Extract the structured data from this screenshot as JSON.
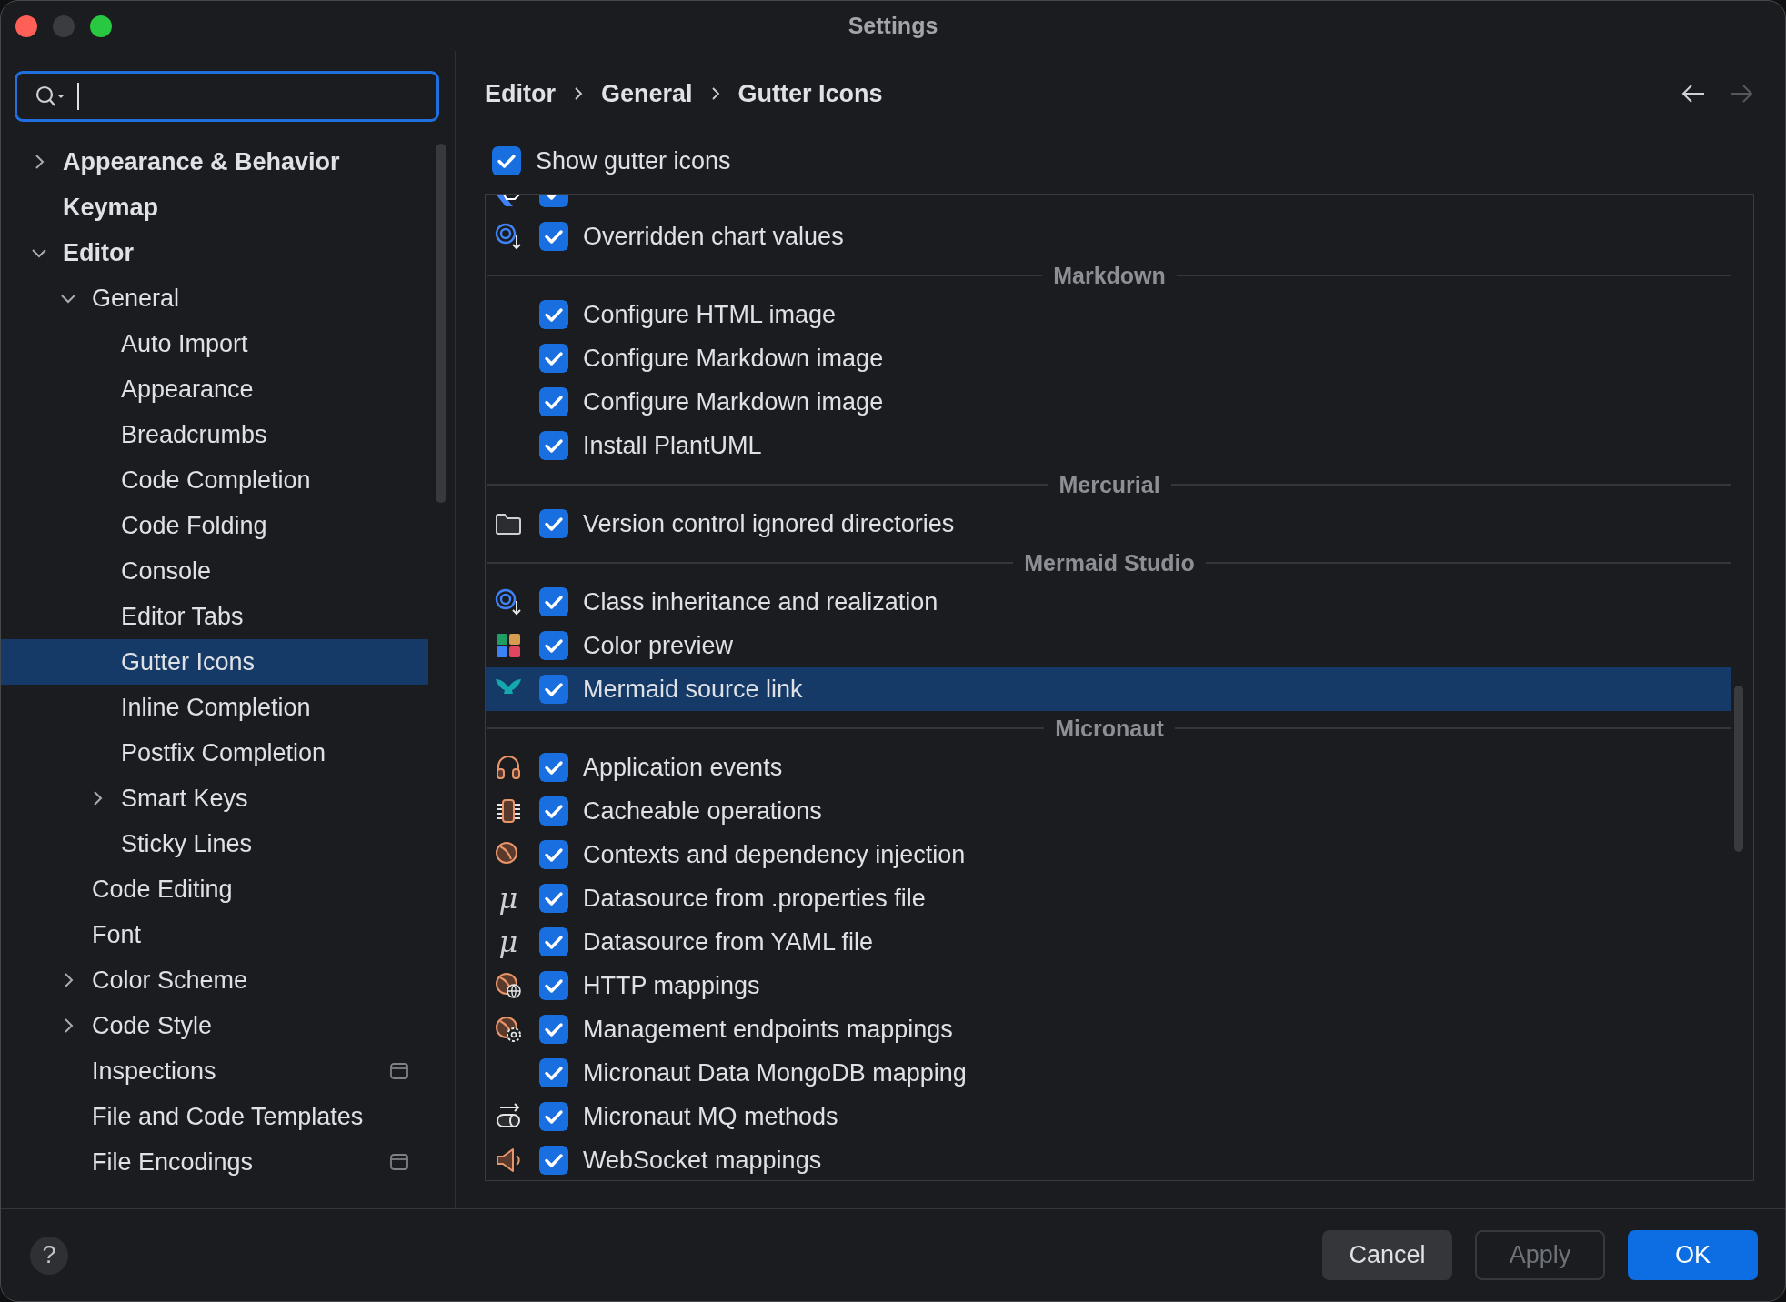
{
  "window": {
    "title": "Settings",
    "buttons": [
      {
        "kind": "close",
        "disabled": false
      },
      {
        "kind": "minimize",
        "disabled": true
      },
      {
        "kind": "zoom",
        "disabled": false
      }
    ]
  },
  "sidebar": {
    "tree": [
      {
        "label": "Appearance & Behavior",
        "selected": false,
        "expanded": false
      },
      {
        "label": "Keymap",
        "selected": false
      },
      {
        "label": "Editor",
        "selected": false,
        "expanded": true,
        "children": [
          {
            "label": "General",
            "selected": false,
            "expanded": true,
            "children": [
              {
                "label": "Auto Import",
                "selected": false
              },
              {
                "label": "Appearance",
                "selected": false
              },
              {
                "label": "Breadcrumbs",
                "selected": false
              },
              {
                "label": "Code Completion",
                "selected": false
              },
              {
                "label": "Code Folding",
                "selected": false
              },
              {
                "label": "Console",
                "selected": false
              },
              {
                "label": "Editor Tabs",
                "selected": false
              },
              {
                "label": "Gutter Icons",
                "selected": true
              },
              {
                "label": "Inline Completion",
                "selected": false
              },
              {
                "label": "Postfix Completion",
                "selected": false
              },
              {
                "label": "Smart Keys",
                "selected": false,
                "expanded": false
              },
              {
                "label": "Sticky Lines",
                "selected": false
              }
            ]
          },
          {
            "label": "Code Editing",
            "selected": false,
            "per_project": false
          },
          {
            "label": "Font",
            "selected": false,
            "per_project": false
          },
          {
            "label": "Color Scheme",
            "selected": false,
            "expanded": false,
            "per_project": false
          },
          {
            "label": "Code Style",
            "selected": false,
            "expanded": false,
            "per_project": false
          },
          {
            "label": "Inspections",
            "selected": false,
            "per_project": true
          },
          {
            "label": "File and Code Templates",
            "selected": false,
            "per_project": false
          },
          {
            "label": "File Encodings",
            "selected": false,
            "per_project": true
          }
        ]
      }
    ]
  },
  "breadcrumbs": [
    "Editor",
    "General",
    "Gutter Icons"
  ],
  "navigation": [
    {
      "kind": "back",
      "disabled": false
    },
    {
      "kind": "forward",
      "disabled": true
    }
  ],
  "show_gutter_icons": {
    "label": "Show gutter icons",
    "checked": true
  },
  "gutter_list": {
    "rows": [
      {
        "kind": "option",
        "checked": true,
        "selected": false
      },
      {
        "kind": "option",
        "label": "Overridden chart values",
        "checked": true,
        "selected": false
      },
      {
        "kind": "group",
        "label": "Markdown"
      },
      {
        "kind": "option",
        "label": "Configure HTML image",
        "checked": true,
        "selected": false
      },
      {
        "kind": "option",
        "label": "Configure Markdown image",
        "checked": true,
        "selected": false
      },
      {
        "kind": "option",
        "label": "Configure Markdown image",
        "checked": true,
        "selected": false
      },
      {
        "kind": "option",
        "label": "Install PlantUML",
        "checked": true,
        "selected": false
      },
      {
        "kind": "group",
        "label": "Mercurial"
      },
      {
        "kind": "option",
        "label": "Version control ignored directories",
        "checked": true,
        "selected": false
      },
      {
        "kind": "group",
        "label": "Mermaid Studio"
      },
      {
        "kind": "option",
        "label": "Class inheritance and realization",
        "checked": true,
        "selected": false
      },
      {
        "kind": "option",
        "label": "Color preview",
        "checked": true,
        "selected": false
      },
      {
        "kind": "option",
        "label": "Mermaid source link",
        "checked": true,
        "selected": true
      },
      {
        "kind": "group",
        "label": "Micronaut"
      },
      {
        "kind": "option",
        "label": "Application events",
        "checked": true,
        "selected": false
      },
      {
        "kind": "option",
        "label": "Cacheable operations",
        "checked": true,
        "selected": false
      },
      {
        "kind": "option",
        "label": "Contexts and dependency injection",
        "checked": true,
        "selected": false
      },
      {
        "kind": "option",
        "label": "Datasource from .properties file",
        "checked": true,
        "selected": false,
        "glyph": "μ"
      },
      {
        "kind": "option",
        "label": "Datasource from YAML file",
        "checked": true,
        "selected": false,
        "glyph": "μ"
      },
      {
        "kind": "option",
        "label": "HTTP mappings",
        "checked": true,
        "selected": false
      },
      {
        "kind": "option",
        "label": "Management endpoints mappings",
        "checked": true,
        "selected": false
      },
      {
        "kind": "option",
        "label": "Micronaut Data MongoDB mapping",
        "checked": true,
        "selected": false
      },
      {
        "kind": "option",
        "label": "Micronaut MQ methods",
        "checked": true,
        "selected": false
      },
      {
        "kind": "option",
        "label": "WebSocket mappings",
        "checked": true,
        "selected": false
      }
    ]
  },
  "help_button": "?",
  "buttons": [
    {
      "label": "Cancel",
      "kind": "normal",
      "disabled": false
    },
    {
      "label": "Apply",
      "kind": "normal",
      "disabled": true
    },
    {
      "label": "OK",
      "kind": "default",
      "disabled": false
    }
  ]
}
